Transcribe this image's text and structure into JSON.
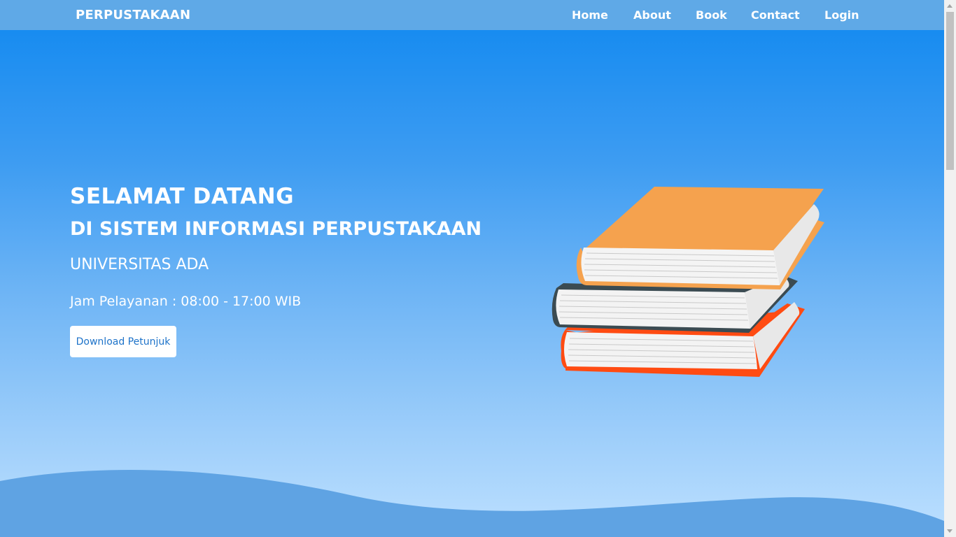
{
  "navbar": {
    "brand": "PERPUSTAKAAN",
    "links": [
      "Home",
      "About",
      "Book",
      "Contact",
      "Login"
    ]
  },
  "hero": {
    "title": "SELAMAT DATANG",
    "subtitle": "DI SISTEM INFORMASI PERPUSTAKAAN",
    "university": "UNIVERSITAS ADA",
    "hours": "Jam Pelayanan : 08:00 - 17:00 WIB",
    "button_label": "Download Petunjuk",
    "illustration": "stack-of-books-icon"
  },
  "colors": {
    "navbar": "#5fa9e7",
    "gradient_top": "#0f88f0",
    "gradient_bottom": "#bde0ff",
    "wave": "#5fa3e3",
    "book_top": "#f5a24e",
    "book_middle": "#3b4b52",
    "book_bottom": "#ff4b12",
    "button_text": "#1e73c9"
  }
}
